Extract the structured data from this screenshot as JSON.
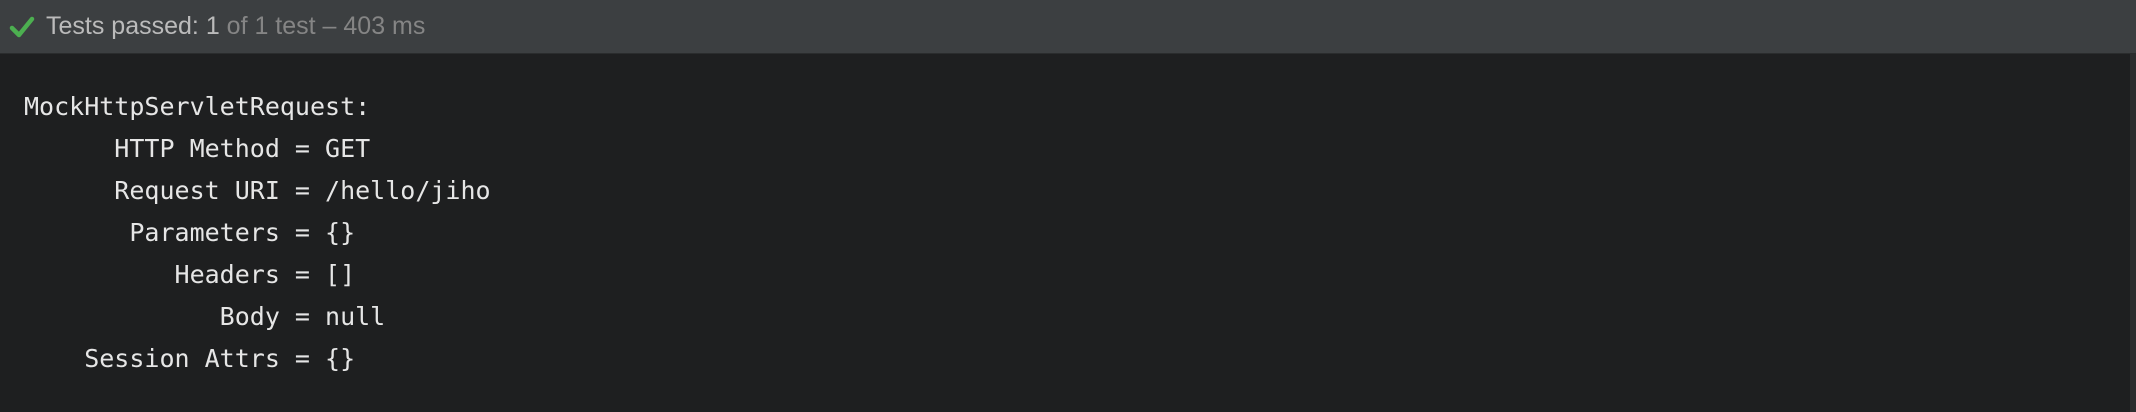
{
  "status": {
    "icon": "check-icon",
    "icon_color": "#4caf50",
    "passed_label": "Tests passed: ",
    "passed_count": "1",
    "passed_detail": " of 1 test – 403 ms"
  },
  "console": {
    "lines": [
      "MockHttpServletRequest:",
      "      HTTP Method = GET",
      "      Request URI = /hello/jiho",
      "       Parameters = {}",
      "          Headers = []",
      "             Body = null",
      "    Session Attrs = {}"
    ]
  }
}
